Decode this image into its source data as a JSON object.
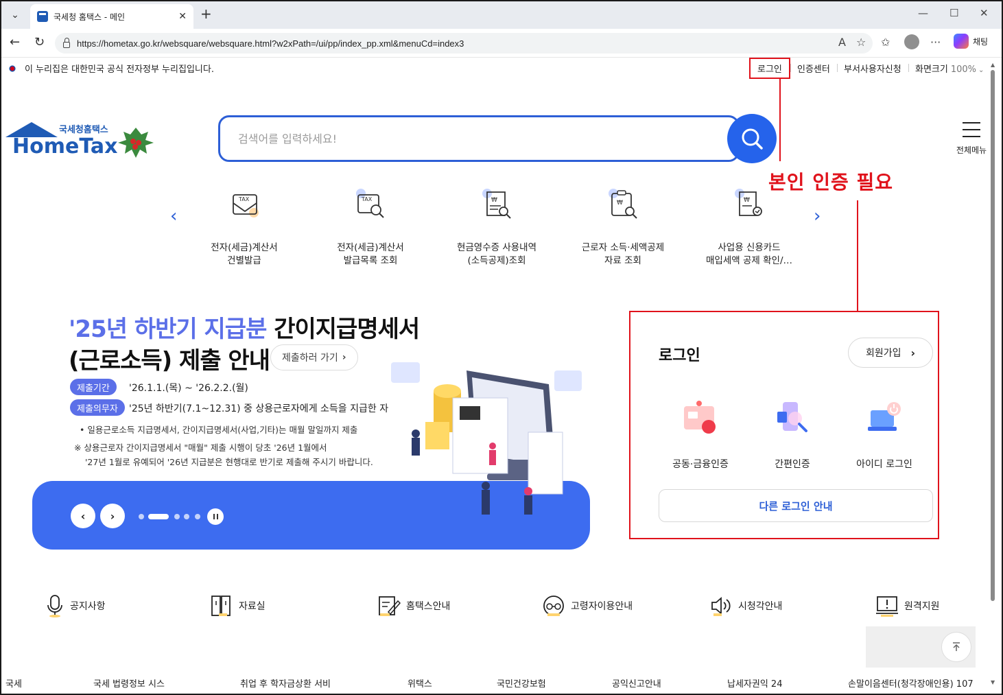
{
  "browser": {
    "tab_title": "국세청 홈택스 - 메인",
    "url": "https://hometax.go.kr/websquare/websquare.html?w2xPath=/ui/pp/index_pp.xml&menuCd=index3",
    "chat_label": "채팅"
  },
  "gov_notice": "이 누리집은 대한민국 공식 전자정부 누리집입니다.",
  "util_links": {
    "login": "로그인",
    "cert_center": "인증센터",
    "dept_user": "부서사용자신청",
    "screen_size": "화면크기",
    "zoom": "100%"
  },
  "annotation": {
    "text": "본인 인증 필요"
  },
  "logo": {
    "sub": "국세청홈택스",
    "main": "HomeTax"
  },
  "search": {
    "placeholder": "검색어를 입력하세요!"
  },
  "all_menu_label": "전체메뉴",
  "quick_services": [
    {
      "line1": "전자(세금)계산서",
      "line2": "건별발급"
    },
    {
      "line1": "전자(세금)계산서",
      "line2": "발급목록 조회"
    },
    {
      "line1": "현금영수증 사용내역",
      "line2": "(소득공제)조회"
    },
    {
      "line1": "근로자 소득·세액공제",
      "line2": "자료 조회"
    },
    {
      "line1": "사업용 신용카드",
      "line2": "매입세액 공제 확인/…"
    }
  ],
  "banner": {
    "title_highlight": "'25년 하반기 지급분",
    "title_rest": " 간이지급명세서",
    "title_line2": "(근로소득) 제출 안내",
    "go_button": "제출하러 가기",
    "period_label": "제출기간",
    "period_text": "'26.1.1.(목) ~ '26.2.2.(월)",
    "duty_label": "제출의무자",
    "duty_text": "'25년 하반기(7.1~12.31) 중 상용근로자에게 소득을 지급한 자",
    "note1": "• 일용근로소득 지급명세서, 간이지급명세서(사업,기타)는 매월 말일까지 제출",
    "note2": "※ 상용근로자 간이지급명세서 \"매월\" 제출 시행이 당초 '26년 1월에서",
    "note3": "'27년 1월로 유예되어 '26년 지급분은 현행대로 반기로 제출해 주시기 바랍니다."
  },
  "login": {
    "title": "로그인",
    "join": "회원가입",
    "options": [
      "공동·금융인증",
      "간편인증",
      "아이디 로그인"
    ],
    "other": "다른 로그인 안내"
  },
  "bottom_menu": [
    "공지사항",
    "자료실",
    "홈택스안내",
    "고령자이용안내",
    "시청각안내",
    "원격지원"
  ],
  "footer_links": [
    "국세",
    "국세 법령정보 시스",
    "취업 후 학자금상환 서비",
    "위택스",
    "국민건강보험",
    "공익신고안내",
    "납세자권익 24",
    "손말이음센터(청각장애인용) 107"
  ],
  "colors": {
    "brand": "#1f5bb5",
    "accent_blue": "#2563eb",
    "banner_blue": "#3d6cf0",
    "highlight": "#5b6fe8",
    "annotation_red": "#e0121b"
  }
}
